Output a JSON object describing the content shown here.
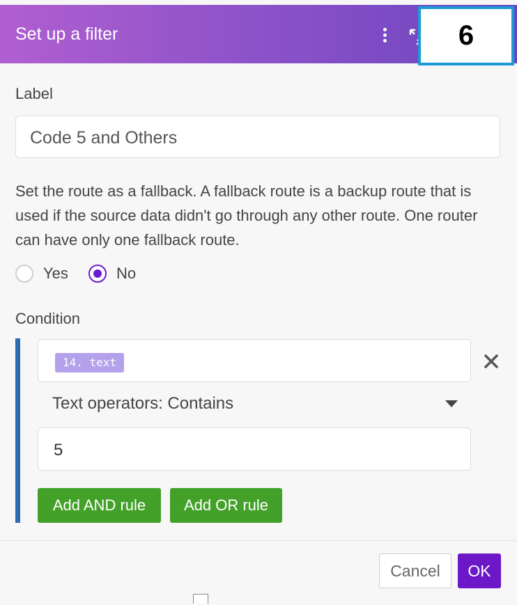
{
  "dialog": {
    "title": "Set up a filter",
    "step_badge": "6",
    "accent_color": "#6c17c8",
    "header_gradient": [
      "#b05fd0",
      "#6c45be"
    ]
  },
  "header": {
    "menu_icon": "more-vertical-icon",
    "expand_icon": "expand-icon"
  },
  "label_field": {
    "label": "Label",
    "value": "Code 5 and Others"
  },
  "fallback": {
    "help_text": "Set the route as a fallback. A fallback route is a backup route that is used if the source data didn't go through any other route. One router can have only one fallback route.",
    "options": [
      {
        "label": "Yes",
        "selected": false
      },
      {
        "label": "No",
        "selected": true
      }
    ]
  },
  "condition": {
    "label": "Condition",
    "operand_token": "14. text",
    "operator": "Text operators: Contains",
    "value": "5",
    "remove_icon": "close-icon",
    "add_and_label": "Add AND rule",
    "add_or_label": "Add OR rule",
    "button_color": "#43a12a",
    "bar_color": "#2f6bb0"
  },
  "footer": {
    "cancel_label": "Cancel",
    "ok_label": "OK"
  }
}
